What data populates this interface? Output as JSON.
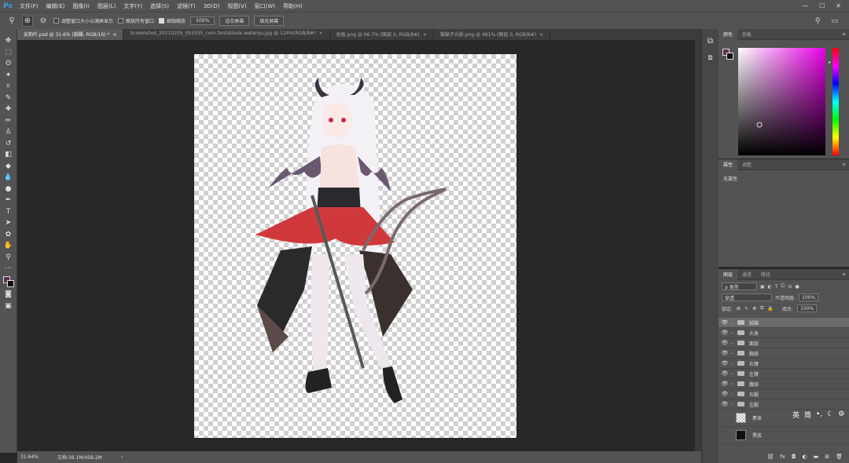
{
  "app": {
    "logo": "Ps"
  },
  "menu": [
    "文件(F)",
    "编辑(E)",
    "图像(I)",
    "图层(L)",
    "文字(Y)",
    "选择(S)",
    "滤镜(T)",
    "3D(D)",
    "视图(V)",
    "窗口(W)",
    "帮助(H)"
  ],
  "options": {
    "resize_windows": "调整窗口大小以满屏显示",
    "zoom_all": "缩放所有窗口",
    "scrubby_zoom": "细微缩放",
    "zoom_value": "100%",
    "fit_screen": "适合屏幕",
    "fill_screen": "填充屏幕"
  },
  "tabs": [
    {
      "label": "安莉叶.psd @ 31.6% (脚踝, RGB/16) *",
      "active": true
    },
    {
      "label": "Screenshot_20210205_091555_com.fantablade.waterqu.jpg @ 124%(RGB/8#)",
      "active": false
    },
    {
      "label": "色板.png @ 66.7% (图层 0, RGB/8#)",
      "active": false
    },
    {
      "label": "猫猫子光影.png @ 491% (图层 0, RGB/8#)",
      "active": false
    }
  ],
  "status": {
    "zoom": "31.64%",
    "doc": "文档:36.1M/458.2M"
  },
  "color_panel": {
    "tabs": [
      "颜色",
      "色板"
    ]
  },
  "properties_panel": {
    "tabs": [
      "属性",
      "调整"
    ],
    "empty": "无属性"
  },
  "layers_panel": {
    "tabs": [
      "图层",
      "通道",
      "路径"
    ],
    "filter": "ρ 类型",
    "blend_mode": "穿透",
    "opacity_label": "不透明度:",
    "opacity_value": "100%",
    "lock_label": "锁定:",
    "fill_label": "填充:",
    "fill_value": "100%",
    "layers": [
      {
        "name": "脚踝",
        "type": "group",
        "selected": true
      },
      {
        "name": "头发",
        "type": "group"
      },
      {
        "name": "面部",
        "type": "group"
      },
      {
        "name": "胸部",
        "type": "group"
      },
      {
        "name": "右臂",
        "type": "group"
      },
      {
        "name": "左臂",
        "type": "group"
      },
      {
        "name": "腹部",
        "type": "group"
      },
      {
        "name": "右腿",
        "type": "group"
      },
      {
        "name": "左腿",
        "type": "group"
      },
      {
        "name": "素体",
        "type": "layer",
        "thumb": "checker"
      },
      {
        "name": "黑底",
        "type": "layer",
        "thumb": "black"
      }
    ]
  },
  "ime": {
    "lang": "英",
    "mode": "简"
  }
}
